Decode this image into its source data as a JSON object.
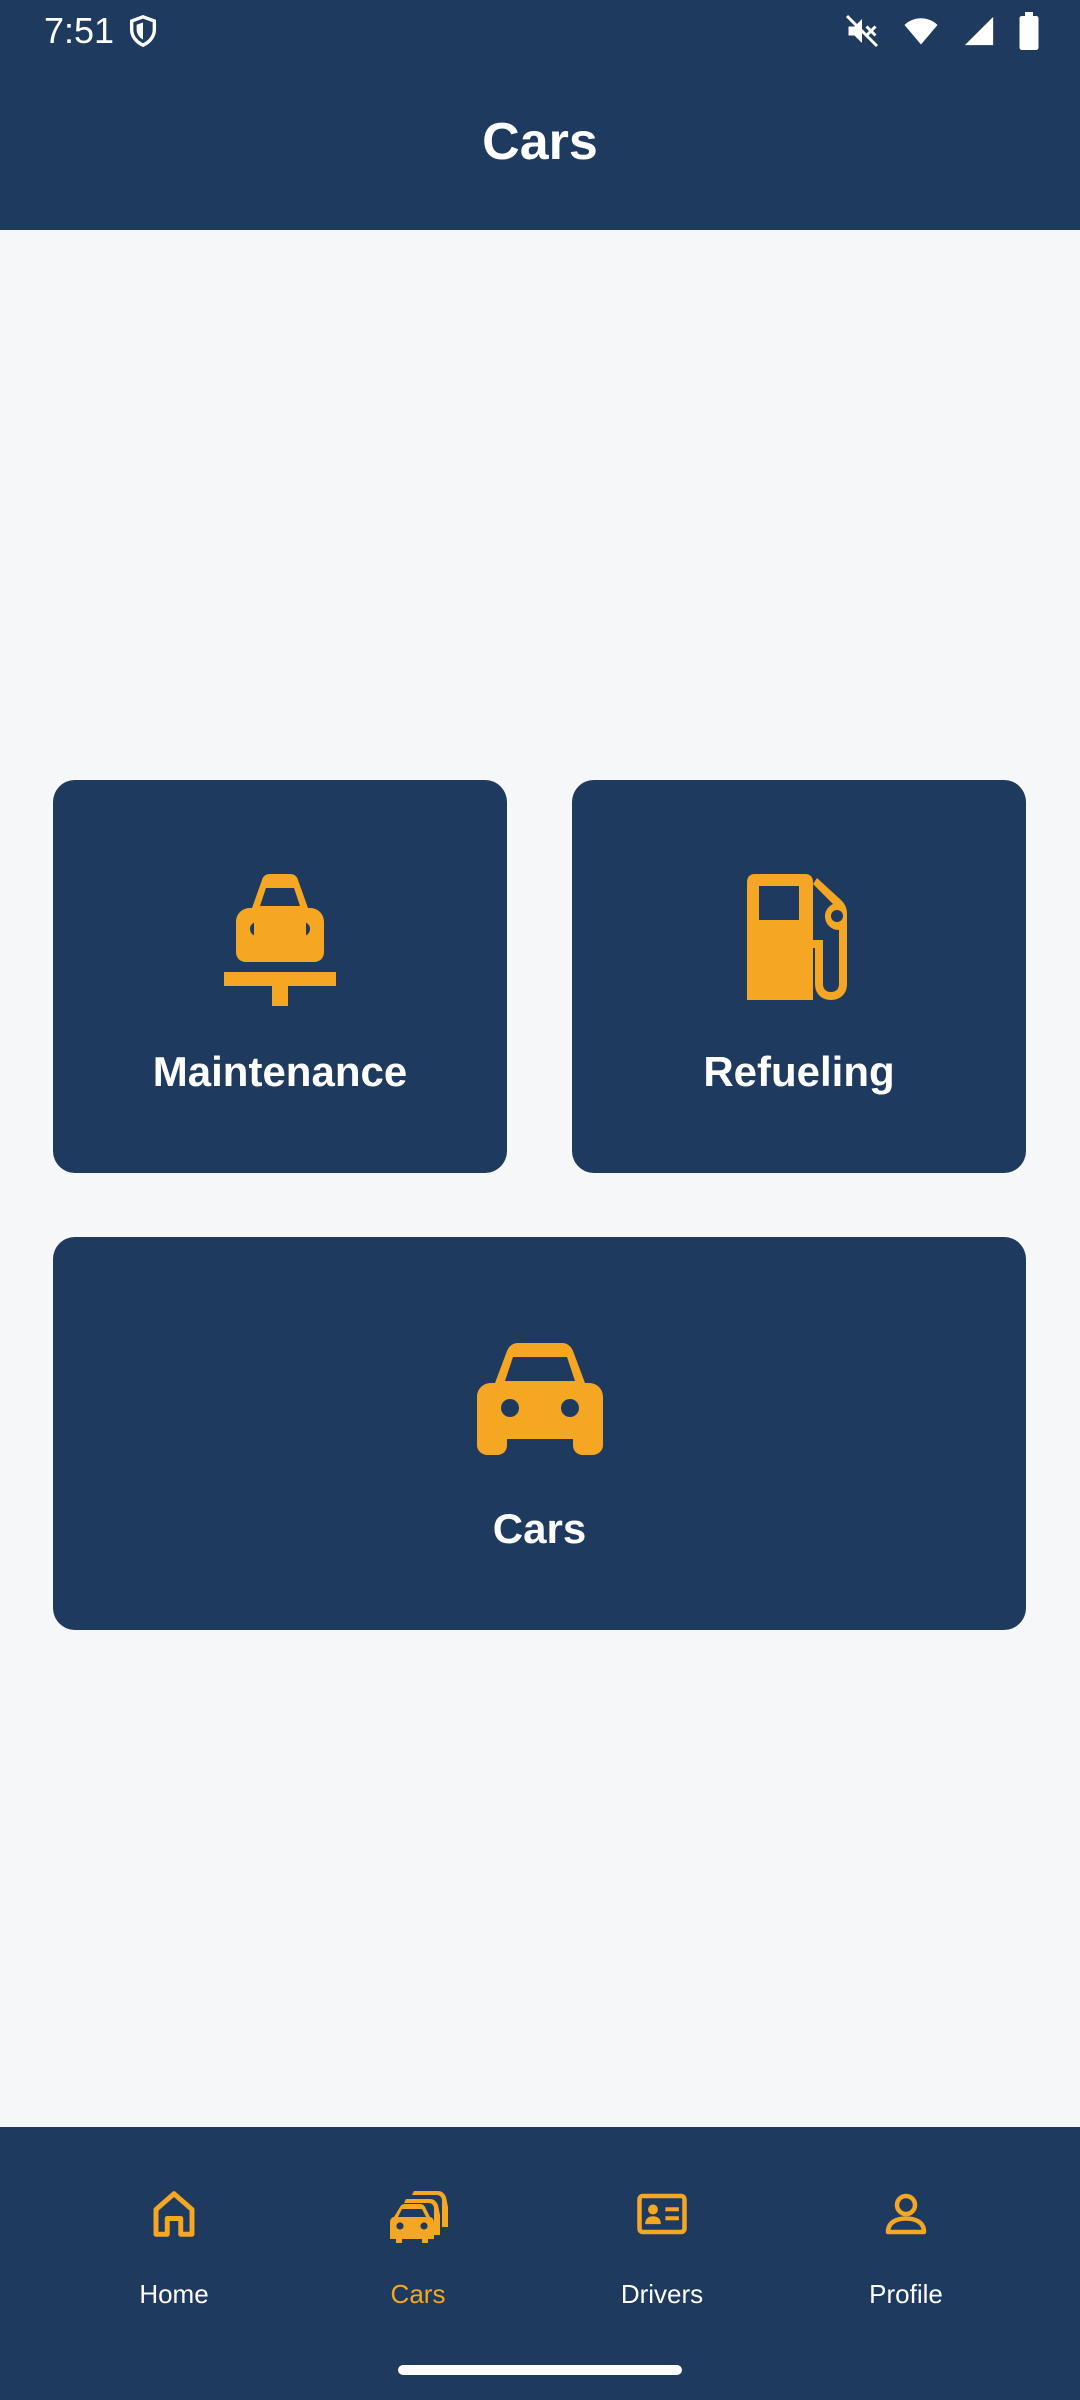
{
  "status_bar": {
    "time": "7:51"
  },
  "header": {
    "title": "Cars"
  },
  "tiles": [
    {
      "label": "Maintenance",
      "icon": "car-maintenance-icon"
    },
    {
      "label": "Refueling",
      "icon": "gas-station-icon"
    },
    {
      "label": "Cars",
      "icon": "car-icon"
    }
  ],
  "bottom_nav": {
    "items": [
      {
        "label": "Home",
        "icon": "home-icon",
        "active": false
      },
      {
        "label": "Cars",
        "icon": "cars-icon",
        "active": true
      },
      {
        "label": "Drivers",
        "icon": "id-card-icon",
        "active": false
      },
      {
        "label": "Profile",
        "icon": "person-icon",
        "active": false
      }
    ]
  },
  "colors": {
    "primary": "#1F3A5F",
    "accent": "#F5A623",
    "background": "#F6F7F9"
  }
}
